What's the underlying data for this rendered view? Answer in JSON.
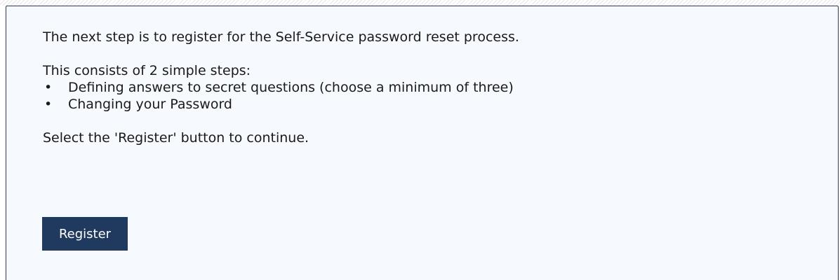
{
  "intro_text": "The next step is to register for the Self-Service password reset process.",
  "steps_heading": "This consists of 2 simple steps:",
  "steps": [
    {
      "bullet": "•",
      "label": "Defining answers to secret questions (choose a minimum of three)"
    },
    {
      "bullet": "•",
      "label": "Changing your Password"
    }
  ],
  "instruction": "Select the 'Register' button to continue.",
  "register_button": {
    "label": "Register"
  },
  "colors": {
    "panel_background": "#f6f9fd",
    "panel_border": "#2e3d55",
    "button_background": "#20395e",
    "button_text": "#ffffff"
  }
}
